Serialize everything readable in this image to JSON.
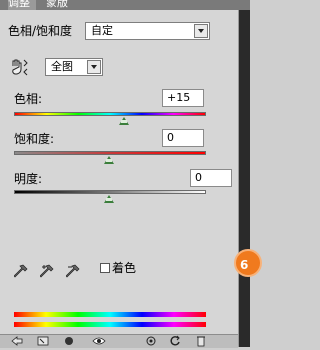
{
  "tabs": [
    {
      "label": "调整",
      "active": true
    },
    {
      "label": "蒙版",
      "active": false
    }
  ],
  "header": {
    "title": "色相/饱和度",
    "preset_value": "自定"
  },
  "channel": {
    "value": "全图"
  },
  "hue": {
    "label": "色相:",
    "value": "+15",
    "level": 0.54
  },
  "saturation": {
    "label": "饱和度:",
    "value": "0",
    "level": 0.5
  },
  "lightness": {
    "label": "明度:",
    "value": "0",
    "level": 0.5
  },
  "colorize": {
    "label": "着色",
    "checked": false
  },
  "badge": {
    "text": "6"
  },
  "icons": [
    "hand-adjust-icon",
    "eyedropper-icon",
    "eyedropper-plus-icon",
    "eyedropper-minus-icon",
    "back-arrow-icon",
    "expand-view-icon",
    "clip-layer-icon",
    "visibility-eye-icon",
    "previous-state-icon",
    "reset-icon",
    "delete-icon"
  ]
}
